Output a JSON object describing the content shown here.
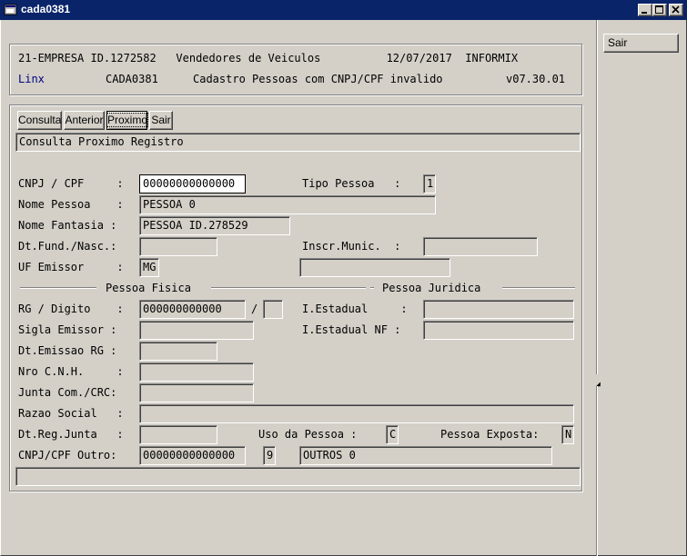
{
  "window": {
    "title": "cada0381",
    "icon": "app-window-icon"
  },
  "header": {
    "line1": "21-EMPRESA ID.1272582   Vendedores de Veiculos          12/07/2017  INFORMIX",
    "brand": "Linx",
    "program": "CADA0381",
    "subtitle": "Cadastro Pessoas com CNPJ/CPF invalido",
    "version": "v07.30.01",
    "brand_color": "#000080"
  },
  "toolbar": {
    "consulta": "Consulta",
    "anterior": "Anterior",
    "proximo": "Proximo",
    "sair": "Sair"
  },
  "status_message": "Consulta Proximo Registro",
  "side": {
    "sair": "Sair"
  },
  "form": {
    "cnpj_label": "CNPJ / CPF     :",
    "cnpj_value": "00000000000000",
    "tipo_label": "Tipo Pessoa   :",
    "tipo_value": "1",
    "nome_label": "Nome Pessoa    :",
    "nome_value": "PESSOA 0",
    "fantasia_label": "Nome Fantasia :",
    "fantasia_value": "PESSOA ID.278529",
    "dtfund_label": "Dt.Fund./Nasc.:",
    "dtfund_value": "",
    "inscr_label": "Inscr.Munic.  :",
    "inscr_value": "",
    "uf_label": "UF Emissor     :",
    "uf_value": "MG",
    "uf_extra": "",
    "section_fisica": "Pessoa Fisica",
    "section_juridica": "Pessoa Juridica",
    "rg_label": "RG / Digito    :",
    "rg_value": "000000000000",
    "rg_slash": "/",
    "rg_digit": "",
    "iestadual_label": "I.Estadual     :",
    "iestadual_value": "",
    "sigla_label": "Sigla Emissor :",
    "sigla_value": "",
    "iestadualnf_label": "I.Estadual NF :",
    "iestadualnf_value": "",
    "dtemissao_label": "Dt.Emissao RG :",
    "dtemissao_value": "",
    "cnh_label": "Nro C.N.H.     :",
    "cnh_value": "",
    "junta_label": "Junta Com./CRC:",
    "junta_value": "",
    "razao_label": "Razao Social   :",
    "razao_value": "",
    "dtreg_label": "Dt.Reg.Junta   :",
    "dtreg_value": "",
    "uso_label": "Uso da Pessoa :",
    "uso_value": "C",
    "exposta_label": "Pessoa Exposta:",
    "exposta_value": "N",
    "outro_label": "CNPJ/CPF Outro:",
    "outro_value": "00000000000000",
    "outro_digit": "9",
    "outro_desc": "OUTROS 0"
  },
  "bottom_status": ""
}
